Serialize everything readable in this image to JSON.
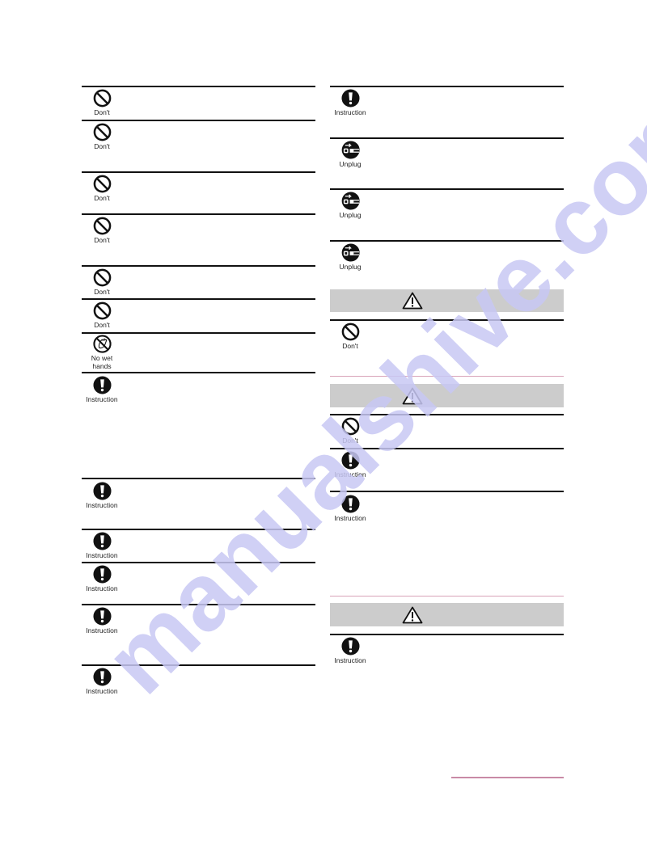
{
  "labels": {
    "dont": "Don't",
    "instruction": "Instruction",
    "unplug": "Unplug",
    "no_wet_hands_1": "No wet",
    "no_wet_hands_2": "hands"
  },
  "left_column": {
    "items": [
      {
        "icon": "prohibition-icon",
        "label": "Don't"
      },
      {
        "icon": "prohibition-icon",
        "label": "Don't"
      },
      {
        "icon": "prohibition-icon",
        "label": "Don't"
      },
      {
        "icon": "prohibition-icon",
        "label": "Don't"
      },
      {
        "icon": "prohibition-icon",
        "label": "Don't"
      },
      {
        "icon": "prohibition-icon",
        "label": "Don't"
      },
      {
        "icon": "no-wet-hands-icon",
        "label": "No wet hands"
      },
      {
        "icon": "exclamation-icon",
        "label": "Instruction"
      },
      {
        "icon": "exclamation-icon",
        "label": "Instruction"
      },
      {
        "icon": "exclamation-icon",
        "label": "Instruction"
      },
      {
        "icon": "exclamation-icon",
        "label": "Instruction"
      },
      {
        "icon": "exclamation-icon",
        "label": "Instruction"
      },
      {
        "icon": "exclamation-icon",
        "label": "Instruction"
      }
    ]
  },
  "right_column": {
    "items": [
      {
        "icon": "exclamation-icon",
        "label": "Instruction"
      },
      {
        "icon": "unplug-icon",
        "label": "Unplug"
      },
      {
        "icon": "unplug-icon",
        "label": "Unplug"
      },
      {
        "icon": "unplug-icon",
        "label": "Unplug"
      }
    ],
    "sections": [
      {
        "header_icon": "warning-triangle-icon",
        "items": [
          {
            "icon": "prohibition-icon",
            "label": "Don't"
          }
        ]
      },
      {
        "header_icon": "warning-triangle-icon",
        "items": [
          {
            "icon": "prohibition-icon",
            "label": "Don't"
          },
          {
            "icon": "exclamation-icon",
            "label": "Instruction"
          },
          {
            "icon": "exclamation-icon",
            "label": "Instruction"
          }
        ]
      },
      {
        "header_icon": "warning-triangle-icon",
        "items": [
          {
            "icon": "exclamation-icon",
            "label": "Instruction"
          }
        ]
      }
    ]
  },
  "watermark": "manualshive.com",
  "colors": {
    "band_gray": "#cccccc",
    "divider_pink": "#d9a3b8",
    "watermark": "#c8c8f4"
  }
}
